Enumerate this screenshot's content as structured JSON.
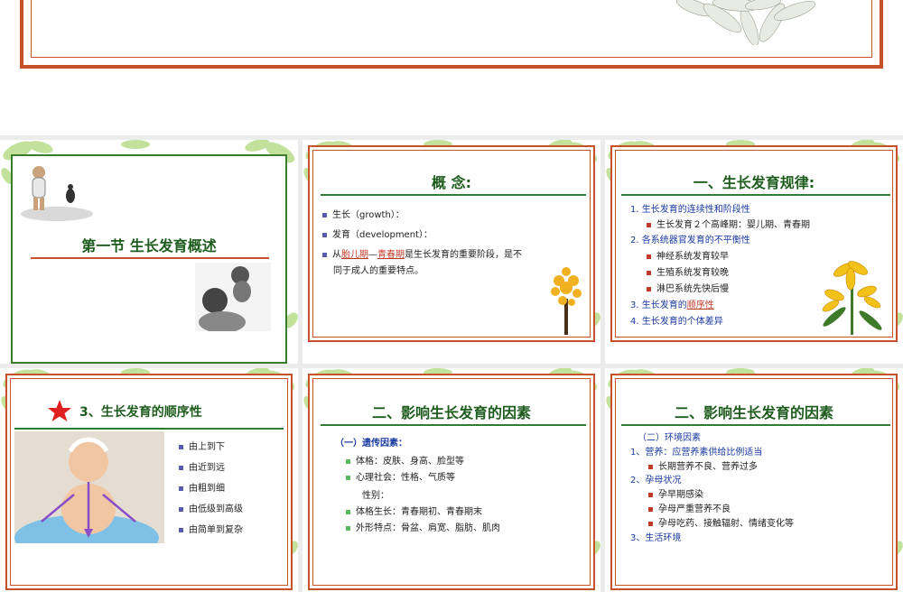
{
  "slides": {
    "s1": {
      "title": "第一节 生长发育概述"
    },
    "s2": {
      "title": "概  念:",
      "b1": "生长（growth）：",
      "b2": "发育（development）：",
      "b3_pre": "从",
      "b3_a": "胎儿期",
      "b3_mid": "—",
      "b3_b": "青春期",
      "b3_post": "是生长发育的重要阶段，是不",
      "b3_line2": "同于成人的重要特点。"
    },
    "s3": {
      "title": "一、生长发育规律:",
      "i1": "1. 生长发育的连续性和阶段性",
      "i1a": "生长发育２个高峰期：婴儿期、青春期",
      "i2": "2. 各系统器官发育的不平衡性",
      "i2a": "神经系统发育较早",
      "i2b": "生殖系统发育较晚",
      "i2c": "淋巴系统先快后慢",
      "i3_pre": "3. 生长发育的",
      "i3_red": "顺序性",
      "i4": "4. 生长发育的个体差异"
    },
    "s4": {
      "title": "3、生长发育的顺序性",
      "items": [
        "由上到下",
        "由近到远",
        "由粗到细",
        "由低级到高级",
        "由简单到复杂"
      ]
    },
    "s5": {
      "title": "二、影响生长发育的因素",
      "sub": "（一）遗传因素：",
      "l1": "体格：皮肤、身高、脸型等",
      "l2": "心理社会：性格、气质等",
      "l3": "性别：",
      "l4": "体格生长：青春期初、青春期末",
      "l5": "外形特点：骨盆、肩宽、脂肪、肌肉"
    },
    "s6": {
      "title": "二、影响生长发育的因素",
      "sub": "（二）环境因素",
      "h1": "1、营养：应营养素供给比例适当",
      "h1a": "长期营养不良、营养过多",
      "h2": "2、孕母状况",
      "h2a": "孕早期感染",
      "h2b": "孕母严重营养不良",
      "h2c": "孕母吃药、接触辐射、情绪变化等",
      "h3": "3、生活环境"
    }
  }
}
